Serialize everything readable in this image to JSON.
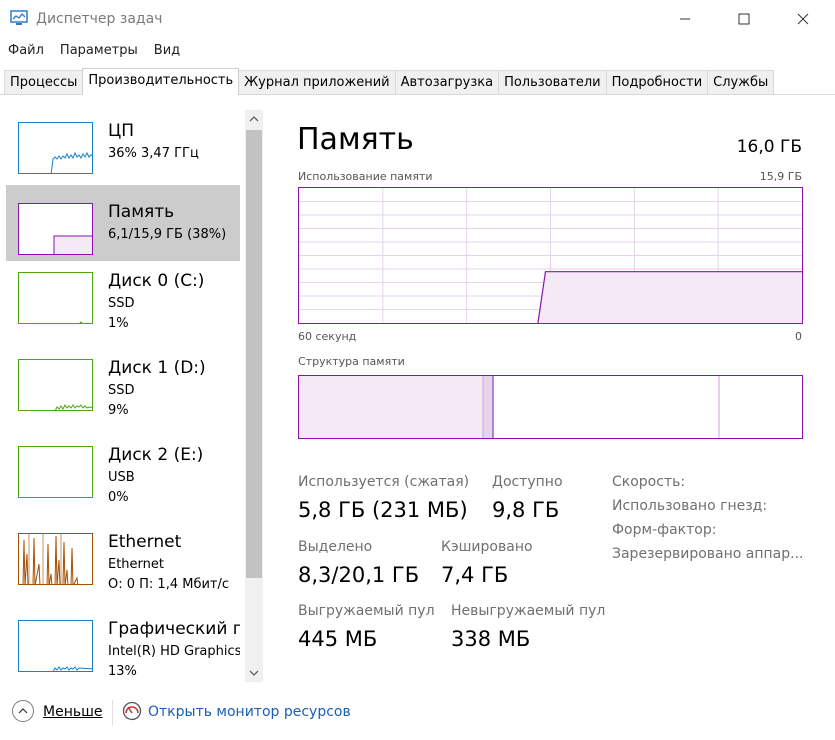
{
  "window": {
    "title": "Диспетчер задач"
  },
  "menu": [
    "Файл",
    "Параметры",
    "Вид"
  ],
  "tabs": [
    {
      "label": "Процессы",
      "active": false
    },
    {
      "label": "Производительность",
      "active": true
    },
    {
      "label": "Журнал приложений",
      "active": false
    },
    {
      "label": "Автозагрузка",
      "active": false
    },
    {
      "label": "Пользователи",
      "active": false
    },
    {
      "label": "Подробности",
      "active": false
    },
    {
      "label": "Службы",
      "active": false
    }
  ],
  "sidebar": {
    "items": [
      {
        "title": "ЦП",
        "line1": "36%  3,47 ГГц",
        "line2": "",
        "color": "#1783c6",
        "selected": false
      },
      {
        "title": "Память",
        "line1": "6,1/15,9 ГБ (38%)",
        "line2": "",
        "color": "#8b12ae",
        "selected": true
      },
      {
        "title": "Диск 0 (C:)",
        "line1": "SSD",
        "line2": "1%",
        "color": "#4da60c",
        "selected": false
      },
      {
        "title": "Диск 1 (D:)",
        "line1": "SSD",
        "line2": "9%",
        "color": "#4da60c",
        "selected": false
      },
      {
        "title": "Диск 2 (E:)",
        "line1": "USB",
        "line2": "0%",
        "color": "#4da60c",
        "selected": false
      },
      {
        "title": "Ethernet",
        "line1": "Ethernet",
        "line2": "О: 0 П: 1,4 Мбит/с",
        "color": "#a74f01",
        "selected": false
      },
      {
        "title": "Графический п",
        "line1": "Intel(R) HD Graphics",
        "line2": "13%",
        "color": "#1783c6",
        "selected": false
      }
    ]
  },
  "main": {
    "title": "Память",
    "total": "16,0 ГБ",
    "usage_chart": {
      "label": "Использование памяти",
      "max_label": "15,9 ГБ",
      "x_left": "60 секунд",
      "x_right": "0",
      "level_fraction": 0.38
    },
    "structure_chart": {
      "label": "Структура памяти"
    },
    "stats": {
      "in_use_label": "Используется (сжатая)",
      "in_use_value": "5,8 ГБ (231 МБ)",
      "available_label": "Доступно",
      "available_value": "9,8 ГБ",
      "committed_label": "Выделено",
      "committed_value": "8,3/20,1 ГБ",
      "cached_label": "Кэшировано",
      "cached_value": "7,4 ГБ",
      "paged_label": "Выгружаемый пул",
      "paged_value": "445 МБ",
      "nonpaged_label": "Невыгружаемый пул",
      "nonpaged_value": "338 МБ"
    },
    "properties": [
      "Скорость:",
      "Использовано гнезд:",
      "Форм-фактор:",
      "Зарезервировано аппар..."
    ]
  },
  "footer": {
    "less_label": "Меньше",
    "resmon_label": "Открыть монитор ресурсов"
  }
}
